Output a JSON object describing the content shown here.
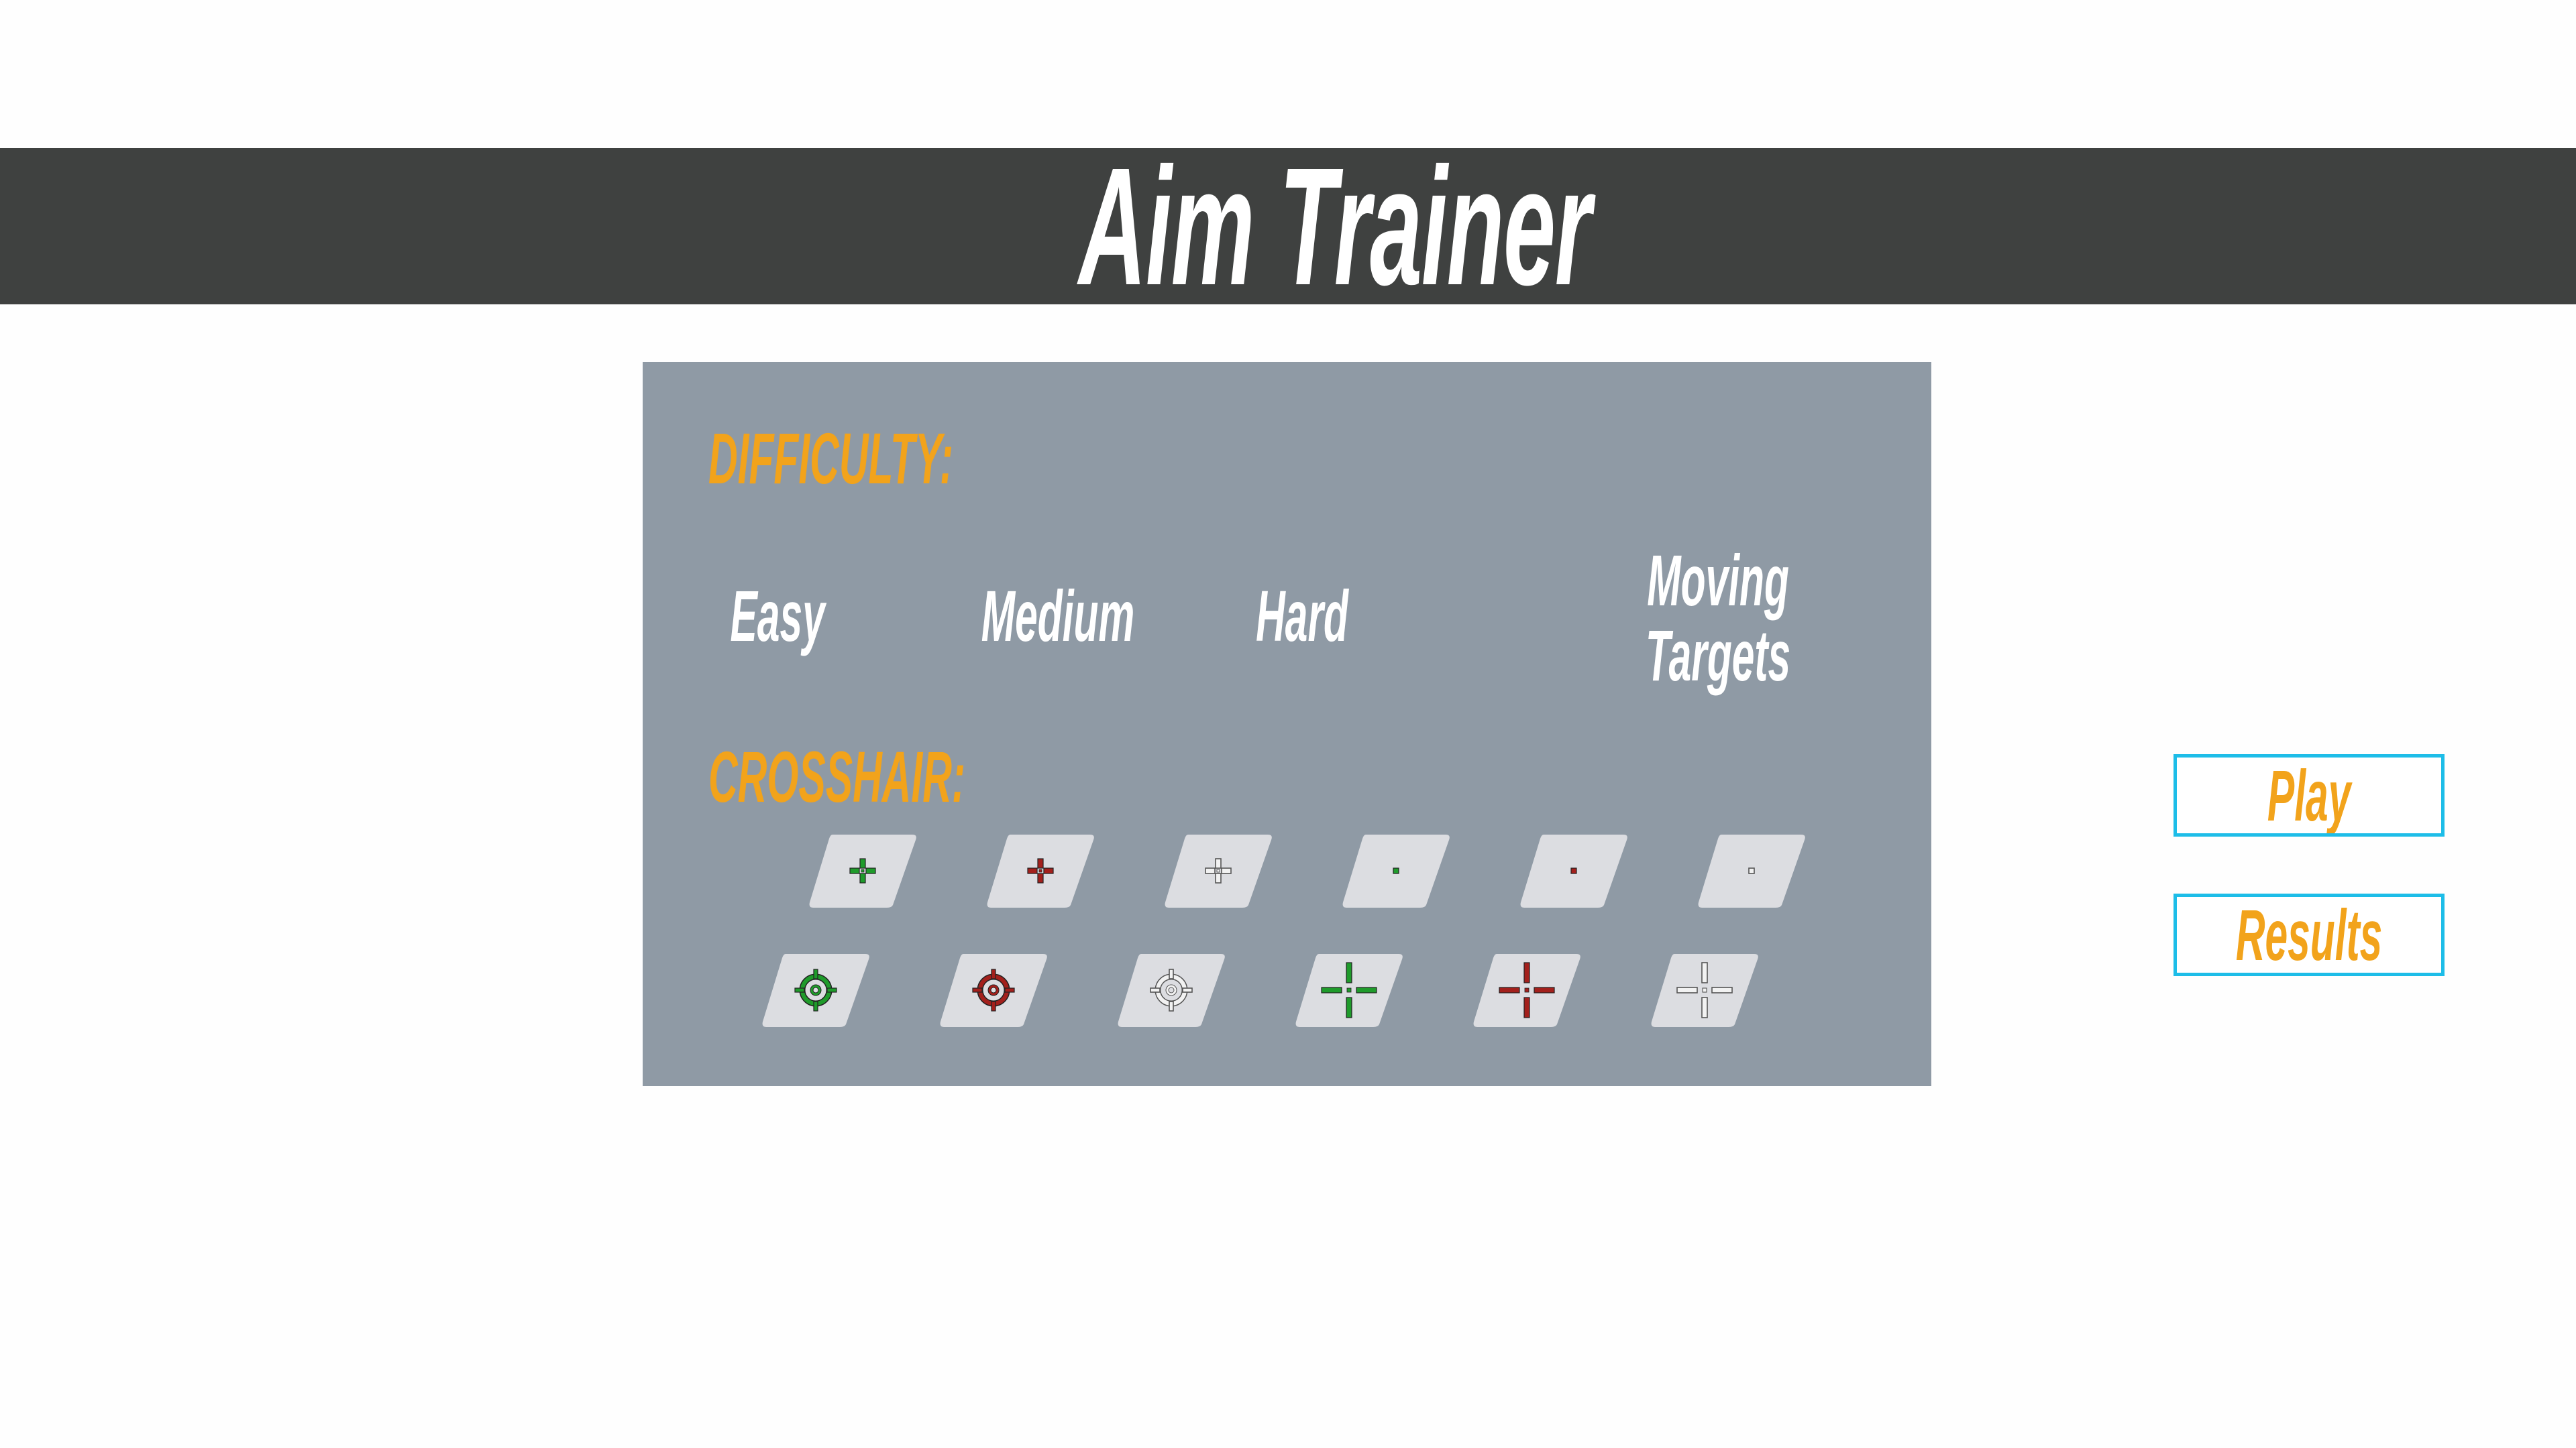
{
  "header": {
    "title": "Aim Trainer"
  },
  "settings": {
    "difficulty_label": "DIFFICULTY:",
    "difficulty_options": [
      {
        "label": "Easy"
      },
      {
        "label": "Medium"
      },
      {
        "label": "Hard"
      },
      {
        "label": "Moving\nTargets"
      }
    ],
    "crosshair_label": "CROSSHAIR:",
    "crosshair_options": [
      {
        "style": "plus-small",
        "color": "#1f9b2b",
        "icon": "green-plus-crosshair-icon"
      },
      {
        "style": "plus-small",
        "color": "#a3201c",
        "icon": "red-plus-crosshair-icon"
      },
      {
        "style": "plus-small-outline",
        "color": "#f2f2f2",
        "icon": "white-plus-crosshair-icon"
      },
      {
        "style": "dot",
        "color": "#1f9b2b",
        "icon": "green-dot-crosshair-icon"
      },
      {
        "style": "dot",
        "color": "#a3201c",
        "icon": "red-dot-crosshair-icon"
      },
      {
        "style": "dot-outline",
        "color": "#f2f2f2",
        "icon": "white-dot-crosshair-icon"
      },
      {
        "style": "circle",
        "color": "#1f9b2b",
        "icon": "green-circle-crosshair-icon"
      },
      {
        "style": "circle",
        "color": "#a3201c",
        "icon": "red-circle-crosshair-icon"
      },
      {
        "style": "circle-outline",
        "color": "#f2f2f2",
        "icon": "white-circle-crosshair-icon"
      },
      {
        "style": "plus-large",
        "color": "#1f9b2b",
        "icon": "green-large-plus-crosshair-icon"
      },
      {
        "style": "plus-large",
        "color": "#a3201c",
        "icon": "red-large-plus-crosshair-icon"
      },
      {
        "style": "plus-large-outline",
        "color": "#f2f2f2",
        "icon": "white-large-plus-crosshair-icon"
      }
    ]
  },
  "menu": {
    "play_label": "Play",
    "results_label": "Results"
  },
  "colors": {
    "header_background": "#3f4140",
    "panel_background": "#8f9aa5",
    "accent_text": "#f2a31b",
    "button_border": "#1dbde8",
    "tile_background": "#dcdde1"
  }
}
